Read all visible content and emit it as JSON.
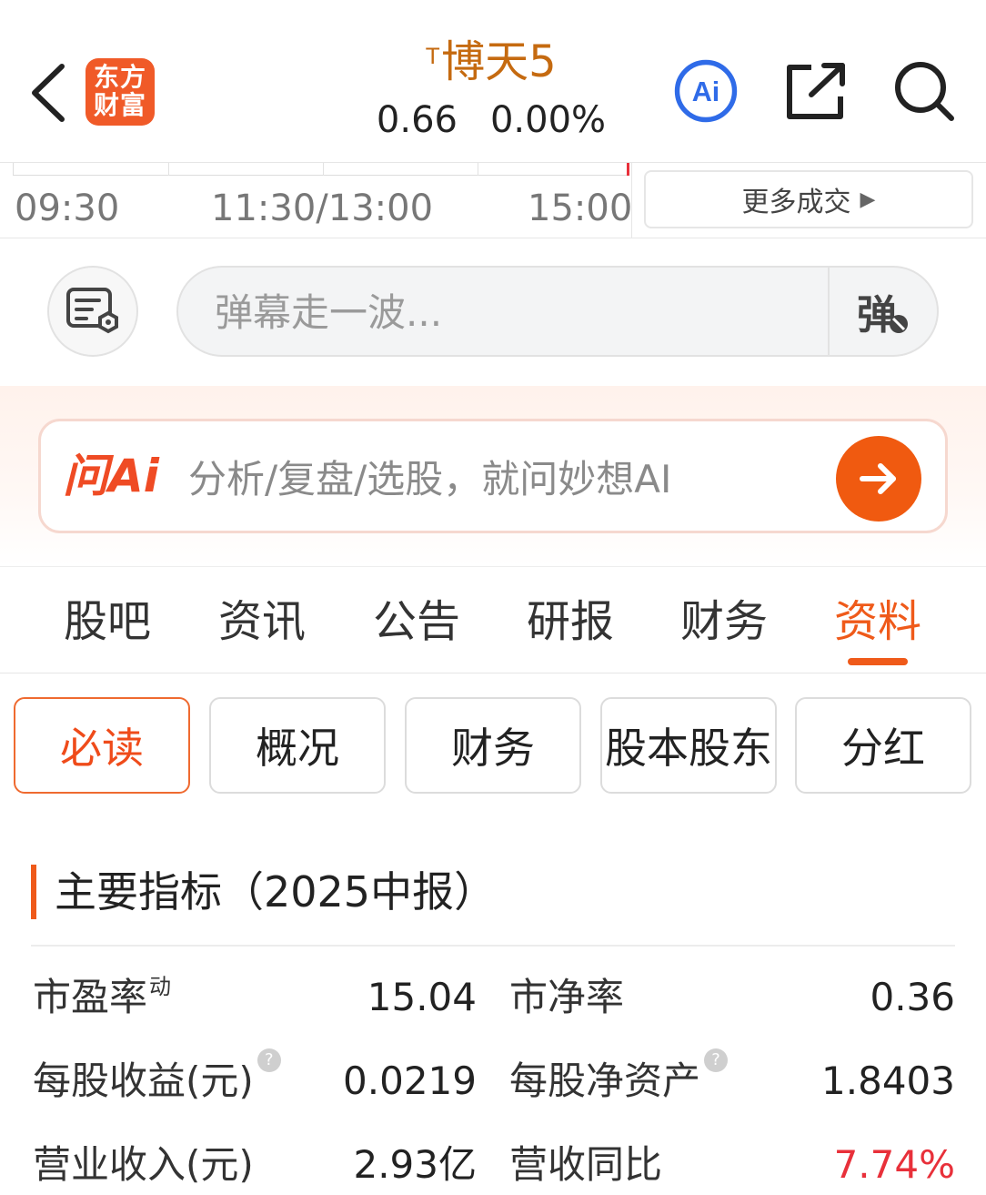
{
  "header": {
    "logo_line1": "东方",
    "logo_line2": "财富",
    "stock_prefix": "T",
    "stock_name": "博天5",
    "price": "0.66",
    "change_pct": "0.00%",
    "ai_badge": "Ai"
  },
  "timeline": {
    "labels": [
      "09:30",
      "11:30/13:00",
      "15:00"
    ],
    "more_trades": "更多成交"
  },
  "danmaku": {
    "placeholder": "弹幕走一波...",
    "send_label": "弹"
  },
  "ask_ai": {
    "brand": "问Ai",
    "hint": "分析/复盘/选股，就问妙想AI"
  },
  "tabs": [
    {
      "label": "股吧"
    },
    {
      "label": "资讯"
    },
    {
      "label": "公告"
    },
    {
      "label": "研报"
    },
    {
      "label": "财务"
    },
    {
      "label": "资料"
    }
  ],
  "active_tab": "资料",
  "subtabs": [
    {
      "label": "必读"
    },
    {
      "label": "概况"
    },
    {
      "label": "财务"
    },
    {
      "label": "股本股东"
    },
    {
      "label": "分红"
    }
  ],
  "active_subtab": "必读",
  "section": {
    "title": "主要指标（2025中报）"
  },
  "metrics": [
    {
      "label": "市盈率",
      "sup": "动",
      "value": "15.04"
    },
    {
      "label": "市净率",
      "value": "0.36"
    },
    {
      "label": "每股收益(元)",
      "help": "?",
      "value": "0.0219"
    },
    {
      "label": "每股净资产",
      "help": "?",
      "value": "1.8403"
    },
    {
      "label": "营业收入(元)",
      "value": "2.93亿"
    },
    {
      "label": "营收同比",
      "value": "7.74%"
    }
  ],
  "colors": {
    "accent": "#ef5a1a",
    "stock_name": "#c56a10",
    "up": "#e8303a",
    "ai_blue": "#2f6be8"
  }
}
